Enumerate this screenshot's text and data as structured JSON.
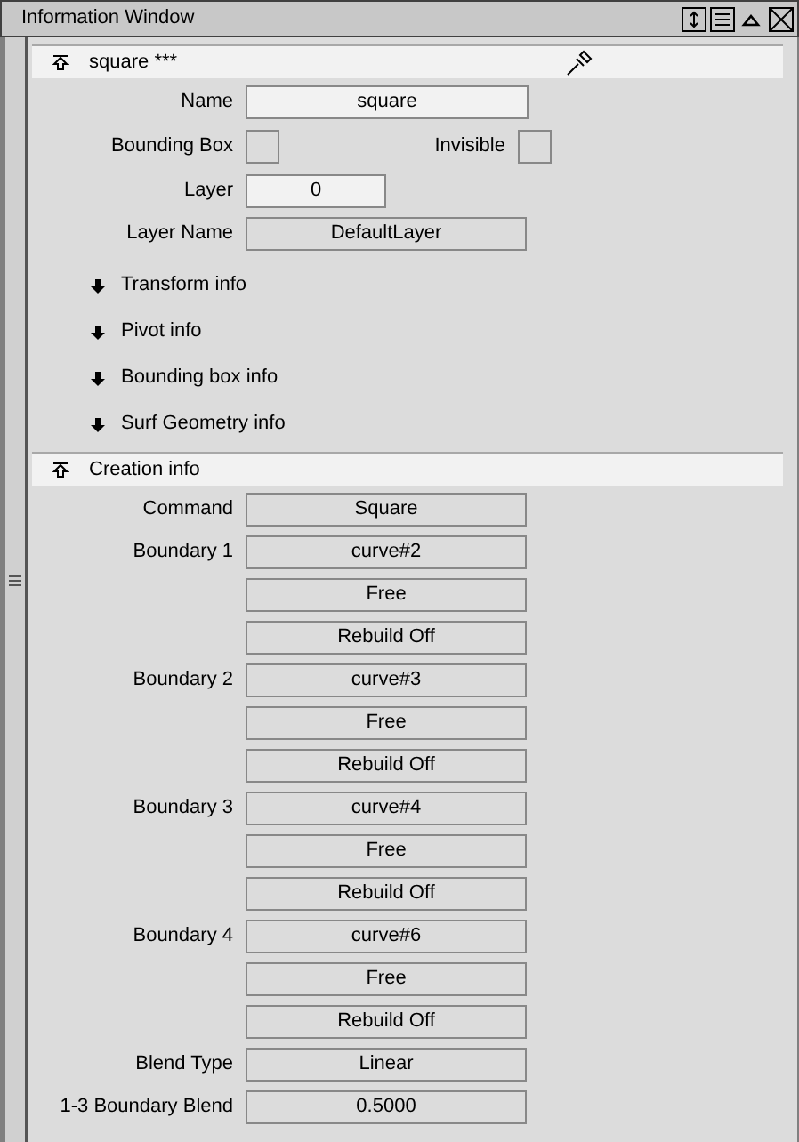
{
  "window": {
    "title": "Information Window"
  },
  "object_section": {
    "title": "square ***",
    "expanded": true,
    "rows": [
      {
        "kind": "input",
        "label": "Name",
        "value": "square"
      },
      {
        "kind": "checks",
        "items": [
          {
            "label": "Bounding Box",
            "checked": false
          },
          {
            "label": "Invisible",
            "checked": false
          }
        ]
      },
      {
        "kind": "short",
        "label": "Layer",
        "value": "0"
      },
      {
        "kind": "display",
        "label": "Layer Name",
        "value": "DefaultLayer"
      }
    ]
  },
  "sections": [
    {
      "title": "Transform info",
      "expanded": false
    },
    {
      "title": "Pivot info",
      "expanded": false
    },
    {
      "title": "Bounding box info",
      "expanded": false
    },
    {
      "title": "Surf Geometry info",
      "expanded": false
    }
  ],
  "creation_section": {
    "title": "Creation info",
    "expanded": true,
    "rows": [
      {
        "label": "Command",
        "value": "Square"
      },
      {
        "label": "Boundary 1",
        "value": "curve#2"
      },
      {
        "value": "Free"
      },
      {
        "value": "Rebuild Off"
      },
      {
        "label": "Boundary 2",
        "value": "curve#3"
      },
      {
        "value": "Free"
      },
      {
        "value": "Rebuild Off"
      },
      {
        "label": "Boundary 3",
        "value": "curve#4"
      },
      {
        "value": "Free"
      },
      {
        "value": "Rebuild Off"
      },
      {
        "label": "Boundary 4",
        "value": "curve#6"
      },
      {
        "value": "Free"
      },
      {
        "value": "Rebuild Off"
      },
      {
        "label": "Blend Type",
        "value": "Linear"
      },
      {
        "label": "1-3 Boundary Blend",
        "value": "0.5000"
      }
    ]
  }
}
